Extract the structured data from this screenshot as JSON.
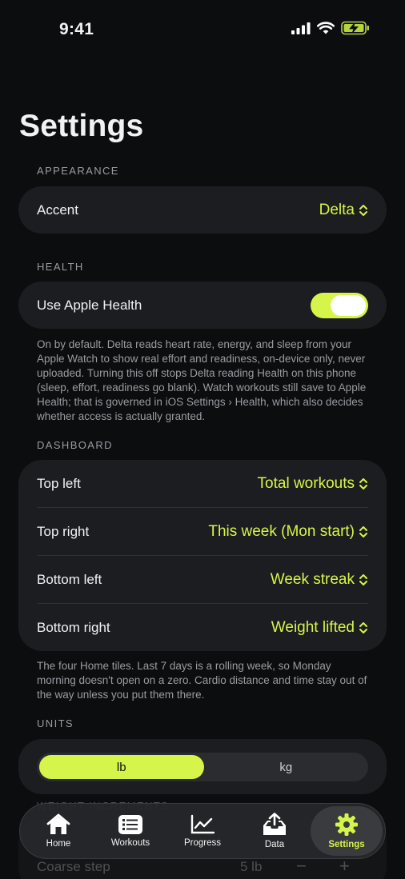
{
  "status": {
    "time": "9:41"
  },
  "title": "Settings",
  "appearance": {
    "label": "APPEARANCE",
    "accent_label": "Accent",
    "accent_value": "Delta"
  },
  "health": {
    "label": "HEALTH",
    "use_label": "Use Apple Health",
    "toggle_on": true,
    "note": "On by default. Delta reads heart rate, energy, and sleep from your Apple Watch to show real effort and readiness, on-device only, never uploaded. Turning this off stops Delta reading Health on this phone (sleep, effort, readiness go blank). Watch workouts still save to Apple Health; that is governed in iOS Settings › Health, which also decides whether access is actually granted."
  },
  "dashboard": {
    "label": "DASHBOARD",
    "rows": [
      {
        "label": "Top left",
        "value": "Total workouts"
      },
      {
        "label": "Top right",
        "value": "This week (Mon start)"
      },
      {
        "label": "Bottom left",
        "value": "Week streak"
      },
      {
        "label": "Bottom right",
        "value": "Weight lifted"
      }
    ],
    "note": "The four Home tiles. Last 7 days is a rolling week, so Monday morning doesn't open on a zero. Cardio distance and time stay out of the way unless you put them there."
  },
  "units": {
    "label": "UNITS",
    "options": [
      "lb",
      "kg"
    ],
    "selected": "lb"
  },
  "weight_increments": {
    "label": "WEIGHT INCREMENTS",
    "coarse_label": "Coarse step",
    "coarse_value": "5 lb",
    "minus": "−",
    "plus": "+"
  },
  "tabs": [
    {
      "label": "Home",
      "icon": "house-icon"
    },
    {
      "label": "Workouts",
      "icon": "list-card-icon"
    },
    {
      "label": "Progress",
      "icon": "line-chart-icon"
    },
    {
      "label": "Data",
      "icon": "tray-upload-icon"
    },
    {
      "label": "Settings",
      "icon": "gear-icon",
      "active": true
    }
  ],
  "colors": {
    "accent": "#d6f54a",
    "background": "#0c0d0f",
    "card": "#1c1d20",
    "muted": "#9a9ca2"
  }
}
